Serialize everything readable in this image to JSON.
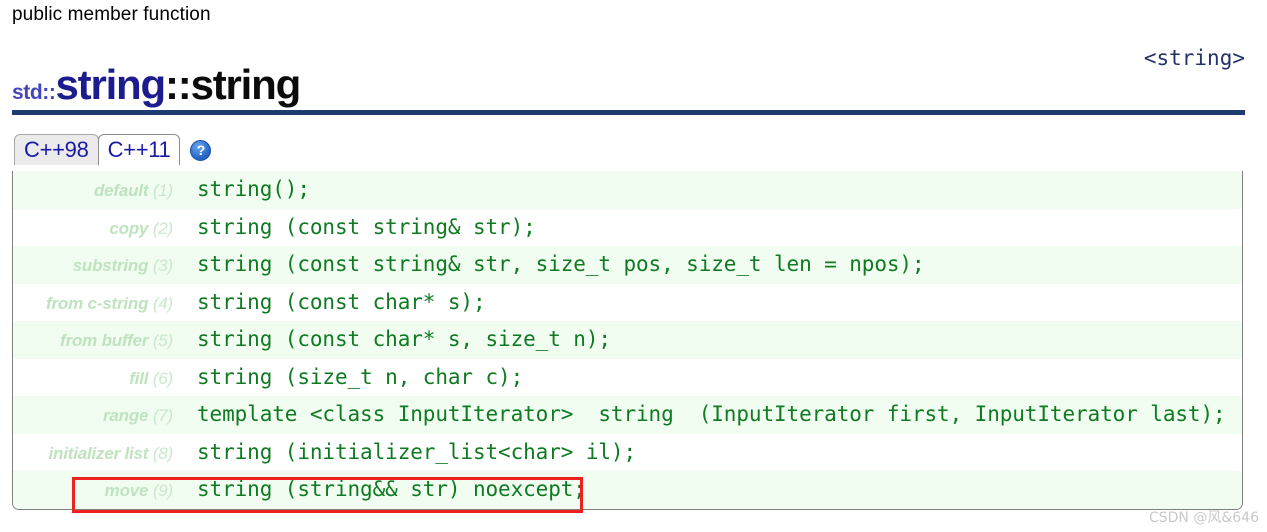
{
  "page": {
    "kind_label": "public member function",
    "include_header": "<string>",
    "watermark": "CSDN @风&646"
  },
  "title": {
    "namespace": "std::",
    "class": "string",
    "separator": "::",
    "member": "string"
  },
  "tabs": [
    {
      "label": "C++98",
      "active": false
    },
    {
      "label": "C++11",
      "active": true
    }
  ],
  "help": {
    "icon": "question-mark-icon",
    "glyph": "?"
  },
  "colors": {
    "divider_navy": "#1e3b72",
    "class_blue": "#1c1c8e",
    "namespace_blue": "#4646bb",
    "code_green": "#0f7a22",
    "row_stripe": "#f2fdf2",
    "label_green": "#bfe3bf",
    "annotation_red": "#ee2020",
    "include_navy": "#22336b"
  },
  "signatures": [
    {
      "label": "default",
      "num": "(1)",
      "code": "string();"
    },
    {
      "label": "copy",
      "num": "(2)",
      "code": "string (const string& str);"
    },
    {
      "label": "substring",
      "num": "(3)",
      "code": "string (const string& str, size_t pos, size_t len = npos);"
    },
    {
      "label": "from c-string",
      "num": "(4)",
      "code": "string (const char* s);"
    },
    {
      "label": "from buffer",
      "num": "(5)",
      "code": "string (const char* s, size_t n);"
    },
    {
      "label": "fill",
      "num": "(6)",
      "code": "string (size_t n, char c);"
    },
    {
      "label": "range",
      "num": "(7)",
      "code": "template <class InputIterator>  string  (InputIterator first, InputIterator last);"
    },
    {
      "label": "initializer list",
      "num": "(8)",
      "code": "string (initializer_list<char> il);"
    },
    {
      "label": "move",
      "num": "(9)",
      "code": "string (string&& str) noexcept;"
    }
  ],
  "annotation": {
    "name": "move-constructor-highlight",
    "target_signature_index": 8
  }
}
